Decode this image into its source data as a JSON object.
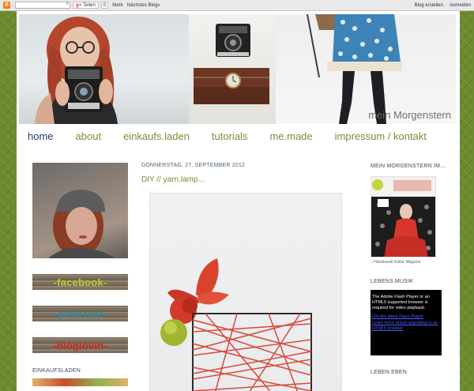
{
  "navbar": {
    "logo_letter": "B",
    "share_label": "Teilen",
    "share_count": "0",
    "more_label": "Mehr",
    "next_blog_label": "Nächstes Blog»",
    "create_blog_label": "Blog erstellen",
    "login_label": "Anmelden"
  },
  "header": {
    "blog_title": "mein Morgenstern"
  },
  "tabs": [
    {
      "label": "home"
    },
    {
      "label": "about"
    },
    {
      "label": "einkaufs.laden"
    },
    {
      "label": "tutorials"
    },
    {
      "label": "me.made"
    },
    {
      "label": "impressum / kontakt"
    }
  ],
  "sidebar_left": {
    "buttons": [
      "-facebook-",
      "-pinterest-",
      "-bloglovin-"
    ],
    "heading": "EINKAUFSLADEN"
  },
  "post": {
    "date": "DONNERSTAG, 27. SEPTEMBER 2012",
    "title": "DIY // yarn.lamp..."
  },
  "sidebar_right": {
    "heading1": "MEIN MORGENSTERN IM...",
    "magazine_caption": ".. Handmade Kultur Magazin",
    "heading2": "LEBENS.MUSIK",
    "flash_text": "The Adobe Flash Player or an HTML5 supported browser is required for video playback.",
    "flash_link1": "Get the latest Flash Player",
    "flash_link2": "Learn more about upgrading to an HTML5 browser",
    "heading3": "LEBEN EBEN"
  },
  "colors": {
    "background_green": "#6e8a2e",
    "tab_green": "#7a8c3a",
    "tab_active": "#1f3d6b",
    "heading_blue": "#3a4d60"
  }
}
